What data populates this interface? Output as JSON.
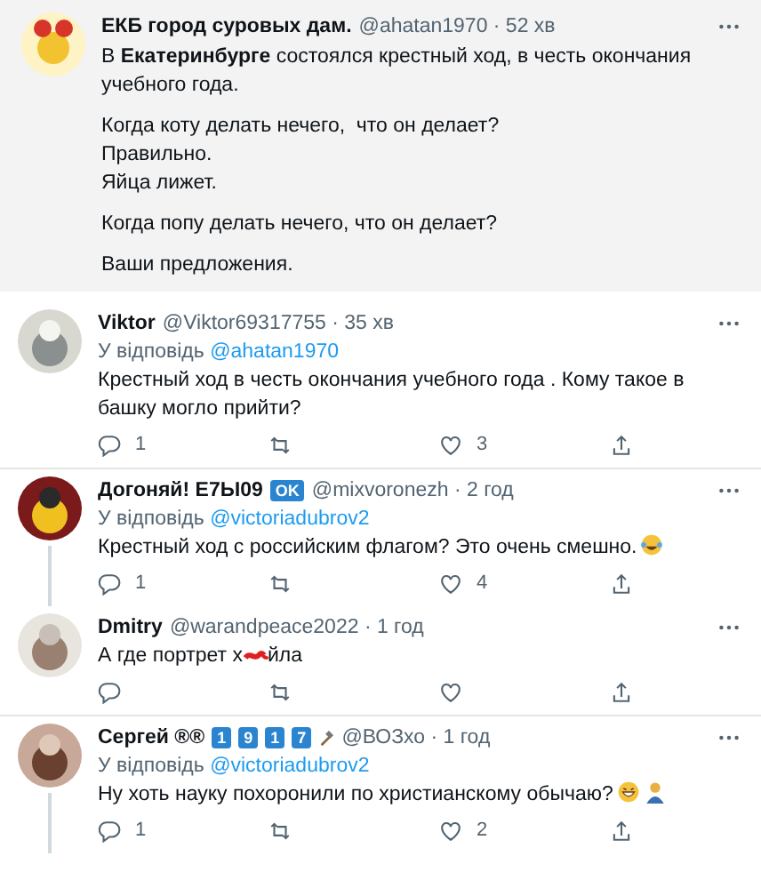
{
  "tweets": [
    {
      "kind": "main",
      "author": "ЕКБ город суровых дам.",
      "meta": "@ahatan1970 · 52 хв",
      "paragraphs": [
        "В **Екатеринбурге** состоялся крестный ход, в честь окончания учебного года.",
        "Когда коту делать нечего,  что он делает?\nПравильно.\nЯйца лижет.",
        "Когда попу делать нечего, что он делает?",
        "Ваши предложения."
      ]
    },
    {
      "kind": "reply",
      "author": "Viktor",
      "meta": "@Viktor69317755 · 35 хв",
      "reply_label": "У відповідь",
      "reply_to": "@ahatan1970",
      "text_parts": [
        "Крестный ход в честь окончания учебного года . Кому такое в башку могло прийти?"
      ],
      "replies": "1",
      "likes": "3",
      "thread_below": false
    },
    {
      "kind": "reply",
      "author": "Догоняй! E7Ы09",
      "badges": [
        "OK"
      ],
      "meta": "@mixvoronezh · 2 год",
      "reply_label": "У відповідь",
      "reply_to": "@victoriadubrov2",
      "text_parts": [
        "Крестный ход с российским флагом? Это очень смешно."
      ],
      "emojis": [
        {
          "kind": "tears-of-joy"
        }
      ],
      "replies": "1",
      "likes": "4",
      "thread_below": true
    },
    {
      "kind": "reply",
      "author": "Dmitry",
      "meta": "@warandpeace2022 · 1 год",
      "text_parts": [
        "А где портрет х",
        "йла"
      ],
      "thread_below": false
    },
    {
      "kind": "reply",
      "author": "Сергей ®®",
      "badges": [
        "1",
        "9",
        "1",
        "7"
      ],
      "meta": "@ВОЗхо · 1 год",
      "reply_label": "У відповідь",
      "reply_to": "@victoriadubrov2",
      "text_parts": [
        "Ну хоть науку похоронили по христианскому обычаю?"
      ],
      "emojis": [
        {
          "kind": "grin"
        },
        {
          "kind": "person"
        }
      ],
      "replies": "1",
      "likes": "2",
      "thread_below": true
    }
  ]
}
